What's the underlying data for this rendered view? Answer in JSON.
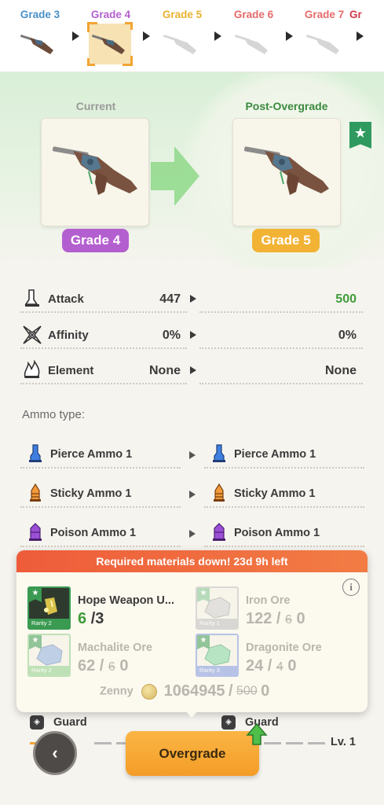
{
  "grade_strip": {
    "grades": [
      {
        "label": "Grade 3",
        "color": "#4a90c8"
      },
      {
        "label": "Grade 4",
        "color": "#b45fcf"
      },
      {
        "label": "Grade 5",
        "color": "#e9b22e"
      },
      {
        "label": "Grade 6",
        "color": "#e66a6a"
      },
      {
        "label": "Grade 7",
        "color": "#e66a6a"
      },
      {
        "label": "Gr",
        "color": "#d23a4a"
      }
    ],
    "selected_index": 1
  },
  "comparison": {
    "current_heading": "Current",
    "post_heading": "Post-Overgrade",
    "current_grade": "Grade 4",
    "post_grade": "Grade 5",
    "current_color": "#b45fcf",
    "post_color": "#f2b335"
  },
  "stats": [
    {
      "name": "Attack",
      "current": "447",
      "new": "500",
      "improved": true,
      "icon": "attack-icon"
    },
    {
      "name": "Affinity",
      "current": "0%",
      "new": "0%",
      "improved": false,
      "icon": "affinity-icon"
    },
    {
      "name": "Element",
      "current": "None",
      "new": "None",
      "improved": false,
      "icon": "element-icon"
    }
  ],
  "ammo": {
    "heading": "Ammo type:",
    "rows": [
      {
        "current": "Pierce Ammo 1",
        "new": "Pierce Ammo 1",
        "icon": "pierce-ammo-icon"
      },
      {
        "current": "Sticky Ammo 1",
        "new": "Sticky Ammo 1",
        "icon": "sticky-ammo-icon"
      },
      {
        "current": "Poison Ammo 1",
        "new": "Poison Ammo 1",
        "icon": "poison-ammo-icon"
      }
    ]
  },
  "materials_popup": {
    "banner": "Required materials down!  23d 9h left",
    "info_icon": "i",
    "items": [
      {
        "name": "Hope Weapon U...",
        "have": "6",
        "need": "/3",
        "old_need": "",
        "rarity": "Rarity 2",
        "available": true
      },
      {
        "name": "Iron Ore",
        "have": "122",
        "need": " 0",
        "old_need": "6",
        "rarity": "Rarity 1",
        "available": false
      },
      {
        "name": "Machalite Ore",
        "have": "62",
        "need": " 0",
        "old_need": "6",
        "rarity": "Rarity 2",
        "available": false
      },
      {
        "name": "Dragonite Ore",
        "have": "24",
        "need": " 0",
        "old_need": "4",
        "rarity": "Rarity 3",
        "available": false
      }
    ],
    "zenny": {
      "label": "Zenny",
      "have": "1064945",
      "old_cost": "500",
      "cost": "0"
    }
  },
  "bottom": {
    "guard_left": "Guard",
    "guard_right": "Guard",
    "level": "Lv. 1",
    "back_icon": "‹",
    "overgrade_label": "Overgrade"
  }
}
